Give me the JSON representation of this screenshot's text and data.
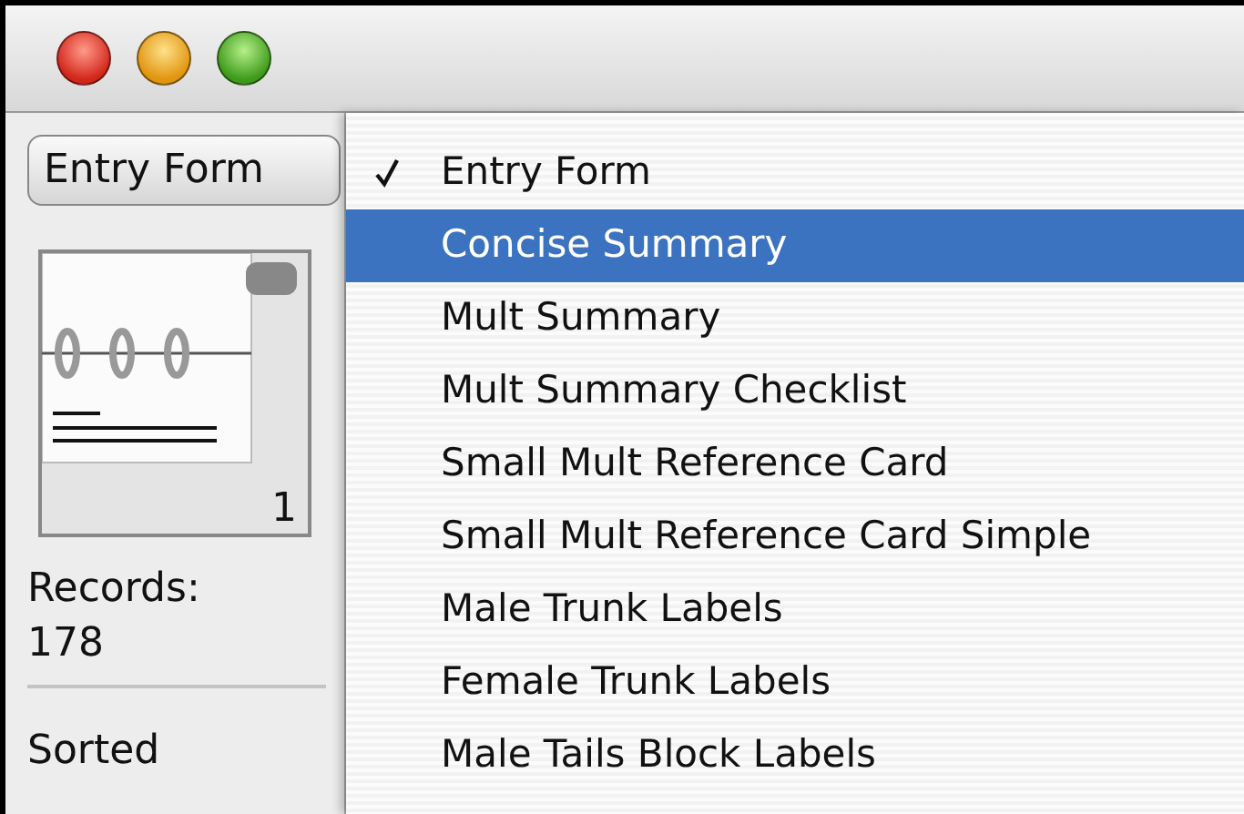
{
  "sidebar": {
    "layout_button": "Entry Form",
    "record_number": "1",
    "records_label": "Records:",
    "records_count": "178",
    "sort_status": "Sorted"
  },
  "menu": {
    "items": [
      {
        "label": "Entry Form",
        "checked": true,
        "selected": false
      },
      {
        "label": "Concise Summary",
        "checked": false,
        "selected": true
      },
      {
        "label": "Mult Summary",
        "checked": false,
        "selected": false
      },
      {
        "label": "Mult Summary Checklist",
        "checked": false,
        "selected": false
      },
      {
        "label": "Small Mult Reference Card",
        "checked": false,
        "selected": false
      },
      {
        "label": "Small Mult Reference Card Simple",
        "checked": false,
        "selected": false
      },
      {
        "label": "Male Trunk Labels",
        "checked": false,
        "selected": false
      },
      {
        "label": "Female Trunk Labels",
        "checked": false,
        "selected": false
      },
      {
        "label": "Male Tails Block Labels",
        "checked": false,
        "selected": false
      }
    ]
  }
}
